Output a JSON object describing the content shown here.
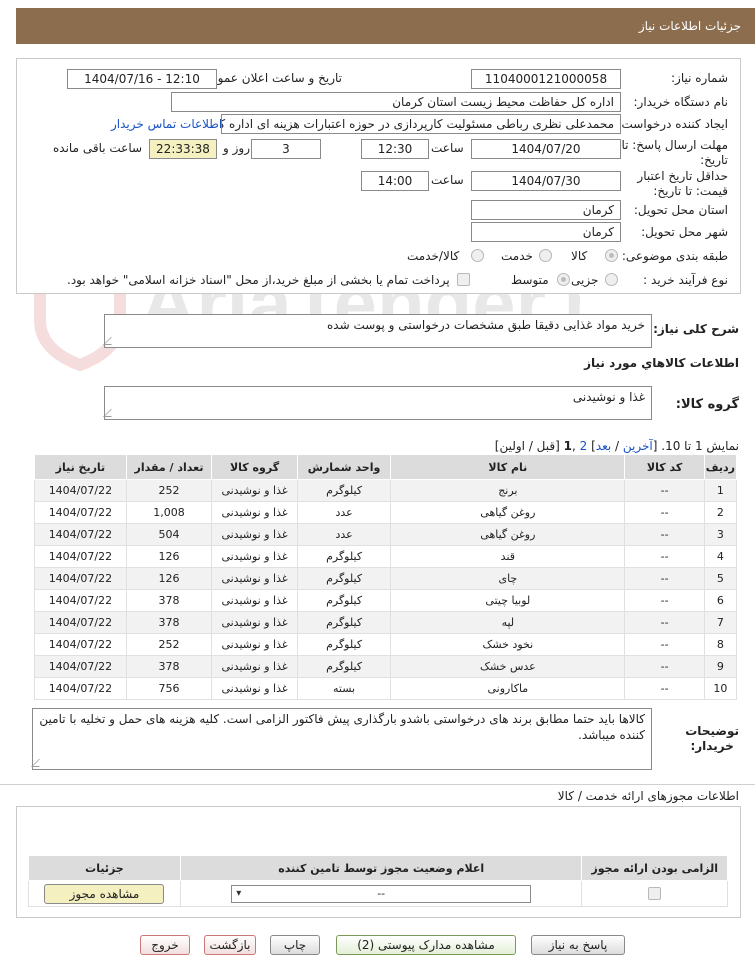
{
  "header": {
    "title": "جزئیات اطلاعات نیاز"
  },
  "info": {
    "need_number_label": "شماره نیاز:",
    "need_number": "1104000121000058",
    "announce_label": "تاریخ و ساعت اعلان عمومی:",
    "announce_value": "1404/07/16 - 12:10",
    "buyer_label": "نام دستگاه خریدار:",
    "buyer_value": "اداره کل حفاظت محیط زیست استان کرمان",
    "creator_label": "ایجاد کننده درخواست:",
    "creator_value": "محمدعلی نظری رباطی مسئولیت کارپردازی در حوزه اعتبارات هزینه ای اداره کل",
    "contact_link": "اطلاعات تماس خریدار",
    "deadline_label": "مهلت ارسال پاسخ: تا تاریخ:",
    "deadline_date": "1404/07/20",
    "time_label": "ساعت",
    "deadline_time": "12:30",
    "days_value": "3",
    "days_label": "روز و",
    "remaining_value": "22:33:38",
    "remaining_label": "ساعت باقی مانده",
    "validity_label": "حداقل تاریخ اعتبار قیمت: تا تاریخ:",
    "validity_date": "1404/07/30",
    "validity_time": "14:00",
    "province_label": "استان محل تحویل:",
    "province_value": "کرمان",
    "city_label": "شهر محل تحویل:",
    "city_value": "کرمان",
    "category_label": "طبقه بندی موضوعی:",
    "category_options": [
      "کالا",
      "خدمت",
      "کالا/خدمت"
    ],
    "process_label": "نوع فرآیند خرید :",
    "process_options": [
      "جزیی",
      "متوسط"
    ],
    "payment_note": "پرداخت تمام یا بخشی از مبلغ خرید،از محل \"اسناد خزانه اسلامی\" خواهد بود."
  },
  "summary": {
    "label": "شرح کلی نیاز:",
    "value": "خرید مواد غذایی دقیقا طبق مشخصات درخواستی و پوست شده"
  },
  "goods_info_title": "اطلاعات کالاهاي مورد نياز",
  "goods_group": {
    "label": "گروه کالا:",
    "value": "غذا و نوشیدنی"
  },
  "pagination": {
    "prefix": "نمایش 1 تا 10. [",
    "last": "آخرین",
    "slash1": " / ",
    "next": "بعد",
    "close_bracket": "]",
    "page2": "2",
    "comma": " ,",
    "page1": "1",
    "rest": " [قبل / اولین]"
  },
  "table": {
    "headers": [
      "ردیف",
      "کد کالا",
      "نام کالا",
      "واحد شمارش",
      "گروه کالا",
      "تعداد / مقدار",
      "تاریخ نیاز"
    ],
    "rows": [
      [
        "1",
        "--",
        "برنج",
        "کیلوگرم",
        "غذا و نوشیدنی",
        "252",
        "1404/07/22"
      ],
      [
        "2",
        "--",
        "روغن گیاهی",
        "عدد",
        "غذا و نوشیدنی",
        "1,008",
        "1404/07/22"
      ],
      [
        "3",
        "--",
        "روغن گیاهی",
        "عدد",
        "غذا و نوشیدنی",
        "504",
        "1404/07/22"
      ],
      [
        "4",
        "--",
        "قند",
        "کیلوگرم",
        "غذا و نوشیدنی",
        "126",
        "1404/07/22"
      ],
      [
        "5",
        "--",
        "چای",
        "کیلوگرم",
        "غذا و نوشیدنی",
        "126",
        "1404/07/22"
      ],
      [
        "6",
        "--",
        "لوبیا چیتی",
        "کیلوگرم",
        "غذا و نوشیدنی",
        "378",
        "1404/07/22"
      ],
      [
        "7",
        "--",
        "لپه",
        "کیلوگرم",
        "غذا و نوشیدنی",
        "378",
        "1404/07/22"
      ],
      [
        "8",
        "--",
        "نخود خشک",
        "کیلوگرم",
        "غذا و نوشیدنی",
        "252",
        "1404/07/22"
      ],
      [
        "9",
        "--",
        "عدس خشک",
        "کیلوگرم",
        "غذا و نوشیدنی",
        "378",
        "1404/07/22"
      ],
      [
        "10",
        "--",
        "ماکارونی",
        "بسته",
        "غذا و نوشیدنی",
        "756",
        "1404/07/22"
      ]
    ]
  },
  "buyer_notes": {
    "label_line1": "توضیحات",
    "label_line2": "خریدار:",
    "value": "کالاها باید حتما مطابق برند های درخواستی باشدو بارگذاری پیش فاکتور الزامی است. کلیه هزینه های حمل و تخلیه با تامین کننده میباشد."
  },
  "permits": {
    "title": "اطلاعات مجوزهای ارائه خدمت / کالا",
    "headers": [
      "الزامی بودن ارائه مجوز",
      "اعلام وضعیت مجوز توسط تامین کننده",
      "جزئیات"
    ],
    "status_select": "--",
    "view_button": "مشاهده مجوز"
  },
  "actions": {
    "reply": "پاسخ به نیاز",
    "attachments": "مشاهده مدارک پیوستی (2)",
    "print": "چاپ",
    "back": "بازگشت",
    "exit": "خروج"
  },
  "watermark_text": "AriaTender.net",
  "colors": {
    "header": "#8c6d4e",
    "link": "#1a52c4",
    "yellow": "#f5f0c0"
  }
}
